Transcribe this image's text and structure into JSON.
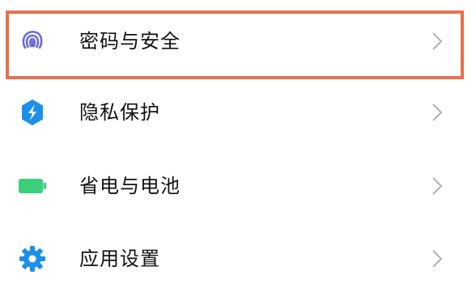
{
  "settings": {
    "items": [
      {
        "label": "密码与安全",
        "icon": "fingerprint-icon",
        "icon_color": "#6b6bd6"
      },
      {
        "label": "隐私保护",
        "icon": "privacy-shield-icon",
        "icon_color": "#1e90e8"
      },
      {
        "label": "省电与电池",
        "icon": "battery-icon",
        "icon_color": "#3ad07a"
      },
      {
        "label": "应用设置",
        "icon": "gear-icon",
        "icon_color": "#1f8fe6"
      }
    ],
    "highlight_color": "#e8704a",
    "chevron_color": "#b0b0b0"
  }
}
